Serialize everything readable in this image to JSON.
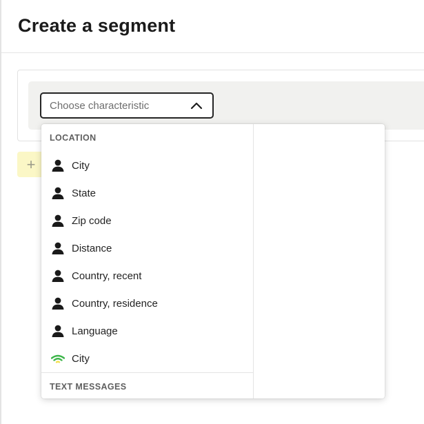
{
  "page": {
    "title": "Create a segment"
  },
  "select": {
    "placeholder": "Choose characteristic"
  },
  "add_button": {
    "symbol": "+"
  },
  "dropdown": {
    "sections": [
      {
        "header": "LOCATION",
        "items": [
          {
            "label": "City",
            "icon": "person-icon"
          },
          {
            "label": "State",
            "icon": "person-icon"
          },
          {
            "label": "Zip code",
            "icon": "person-icon"
          },
          {
            "label": "Distance",
            "icon": "person-icon"
          },
          {
            "label": "Country, recent",
            "icon": "person-icon"
          },
          {
            "label": "Country, residence",
            "icon": "person-icon"
          },
          {
            "label": "Language",
            "icon": "person-icon"
          },
          {
            "label": "City",
            "icon": "wifi-icon"
          }
        ]
      },
      {
        "header": "TEXT MESSAGES",
        "items": []
      }
    ]
  },
  "colors": {
    "accent_yellow": "#fbf7c6",
    "wifi_green": "#3db54a",
    "wifi_yellow": "#f3e04a"
  }
}
